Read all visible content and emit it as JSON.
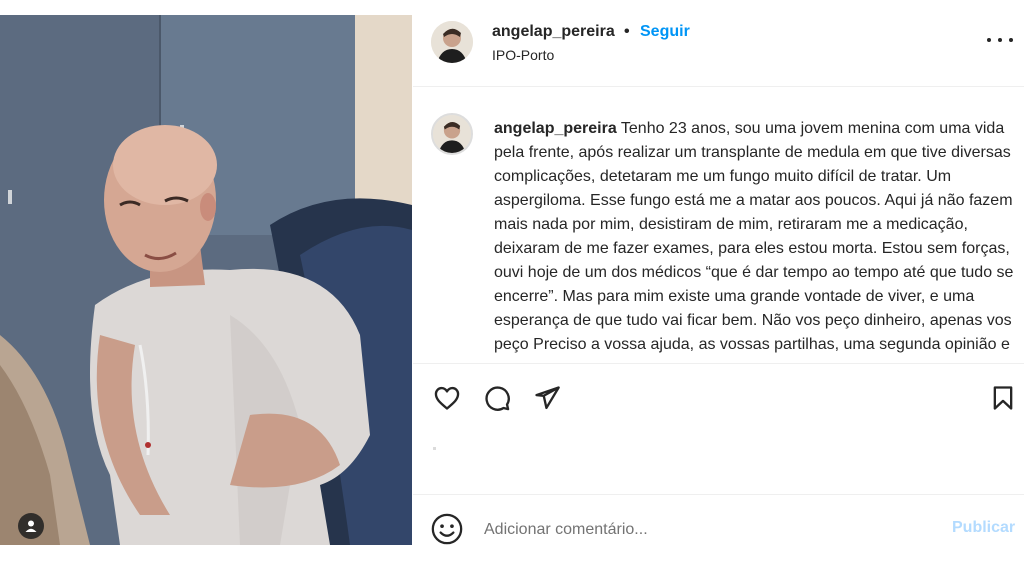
{
  "post": {
    "username": "angelap_pereira",
    "separator": "•",
    "follow_label": "Seguir",
    "location": "IPO-Porto",
    "caption_username": "angelap_pereira",
    "caption_text": "Tenho 23 anos, sou uma jovem menina com uma vida pela frente, após realizar um transplante de medula em que tive diversas complicações, detetaram me um fungo muito difícil de tratar. Um aspergiloma. Esse fungo está me a matar aos poucos. Aqui já não fazem mais nada por mim, desistiram de mim, retiraram me a medicação, deixaram de me fazer exames, para eles estou morta. Estou sem forças, ouvi hoje de um dos médicos “que é dar tempo ao tempo até que tudo se encerre”. Mas para mim existe uma grande vontade de viver, e uma esperança de que tudo vai ficar bem. Não vos peço dinheiro, apenas vos peço Preciso a vossa ajuda, as vossas partilhas, uma segunda opinião e uma"
  },
  "actions": {
    "like_icon": "heart-icon",
    "comment_icon": "comment-icon",
    "share_icon": "send-icon",
    "save_icon": "bookmark-icon"
  },
  "comment": {
    "placeholder": "Adicionar comentário...",
    "publish_label": "Publicar",
    "emoji_icon": "emoji-icon"
  },
  "photo": {
    "tag_icon": "user-tag-icon"
  },
  "colors": {
    "accent": "#0095f6",
    "publish_disabled": "#b3dbff",
    "text": "#262626"
  }
}
